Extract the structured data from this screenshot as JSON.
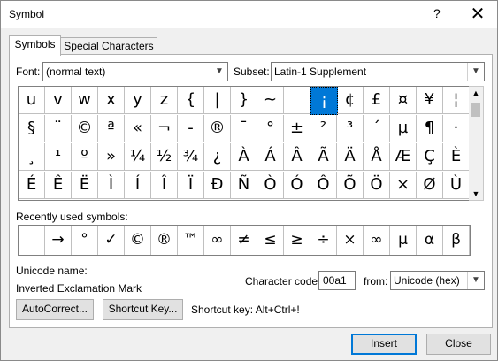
{
  "window": {
    "title": "Symbol",
    "help_label": "?",
    "close_glyph": "✕"
  },
  "tabs": [
    {
      "label": "Symbols",
      "active": true
    },
    {
      "label": "Special Characters",
      "active": false
    }
  ],
  "font": {
    "label": "Font:",
    "value": "(normal text)"
  },
  "subset": {
    "label": "Subset:",
    "value": "Latin-1 Supplement"
  },
  "symbol_grid": {
    "rows": [
      [
        "u",
        "v",
        "w",
        "x",
        "y",
        "z",
        "{",
        "|",
        "}",
        "~",
        "",
        "¡",
        "¢",
        "£",
        "¤",
        "¥",
        "¦"
      ],
      [
        "§",
        "¨",
        "©",
        "ª",
        "«",
        "¬",
        "-",
        "®",
        "¯",
        "°",
        "±",
        "²",
        "³",
        "´",
        "µ",
        "¶",
        "·"
      ],
      [
        "¸",
        "¹",
        "º",
        "»",
        "¼",
        "½",
        "¾",
        "¿",
        "À",
        "Á",
        "Â",
        "Ã",
        "Ä",
        "Å",
        "Æ",
        "Ç",
        "È"
      ],
      [
        "É",
        "Ê",
        "Ë",
        "Ì",
        "Í",
        "Î",
        "Ï",
        "Ð",
        "Ñ",
        "Ò",
        "Ó",
        "Ô",
        "Õ",
        "Ö",
        "×",
        "Ø",
        "Ù"
      ]
    ],
    "selected": "¡"
  },
  "recent": {
    "label": "Recently used symbols:",
    "symbols": [
      "",
      "→",
      "°",
      "✓",
      "©",
      "®",
      "™",
      "∞",
      "≠",
      "≤",
      "≥",
      "÷",
      "×",
      "∞",
      "µ",
      "α",
      "β"
    ]
  },
  "unicode": {
    "name_label": "Unicode name:",
    "name_value": "Inverted Exclamation Mark"
  },
  "char_code": {
    "label": "Character code:",
    "value": "00a1"
  },
  "from": {
    "label": "from:",
    "value": "Unicode (hex)"
  },
  "buttons": {
    "autocorrect": "AutoCorrect...",
    "shortcut_key": "Shortcut Key...",
    "insert": "Insert",
    "close": "Close"
  },
  "shortcut_text": "Shortcut key: Alt+Ctrl+!",
  "icons": {
    "dropdown_arrow": "chevron-down-icon",
    "scroll_up": "triangle-up-icon",
    "scroll_down": "triangle-down-icon"
  }
}
